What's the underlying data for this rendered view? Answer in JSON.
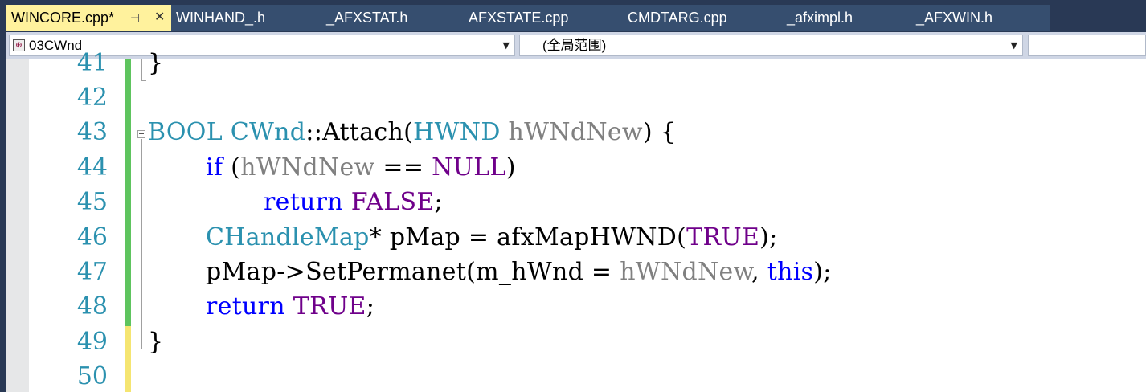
{
  "tabs": [
    {
      "label": "WINCORE.cpp*",
      "active": true
    },
    {
      "label": "WINHAND_.h"
    },
    {
      "label": "_AFXSTAT.h"
    },
    {
      "label": "AFXSTATE.cpp"
    },
    {
      "label": "CMDTARG.cpp"
    },
    {
      "label": "_afximpl.h"
    },
    {
      "label": "_AFXWIN.h"
    }
  ],
  "tab_icons": {
    "pin": "pin-icon",
    "close": "close-icon"
  },
  "navbar": {
    "project": "03CWnd",
    "scope": "(全局范围)"
  },
  "line_numbers": [
    "41",
    "42",
    "43",
    "44",
    "45",
    "46",
    "47",
    "48",
    "49",
    "50"
  ],
  "code": {
    "l41": "}",
    "l43": {
      "t1": "BOOL",
      "t2": "CWnd",
      "t3": "::Attach(",
      "t4": "HWND",
      "t5": " ",
      "t6": "hWNdNew",
      "t7": ") {"
    },
    "l44": {
      "t1": "if",
      "t2": " (",
      "t3": "hWNdNew",
      "t4": " == ",
      "t5": "NULL",
      "t6": ")"
    },
    "l45": {
      "t1": "return",
      "t2": " ",
      "t3": "FALSE",
      "t4": ";"
    },
    "l46": {
      "t1": "CHandleMap",
      "t2": "* pMap = afxMapHWND(",
      "t3": "TRUE",
      "t4": ");"
    },
    "l47": {
      "t1": "pMap->SetPermanet(m_hWnd = ",
      "t2": "hWNdNew",
      "t3": ", ",
      "t4": "this",
      "t5": ");"
    },
    "l48": {
      "t1": "return",
      "t2": " ",
      "t3": "TRUE",
      "t4": ";"
    },
    "l49": "}"
  },
  "colors": {
    "keyword": "#0000ff",
    "type": "#2b91af",
    "parameter": "#808080",
    "macro": "#6f008a",
    "saved_change": "#5ec45e",
    "unsaved_change": "#f5e571",
    "active_tab": "#fff29d"
  }
}
